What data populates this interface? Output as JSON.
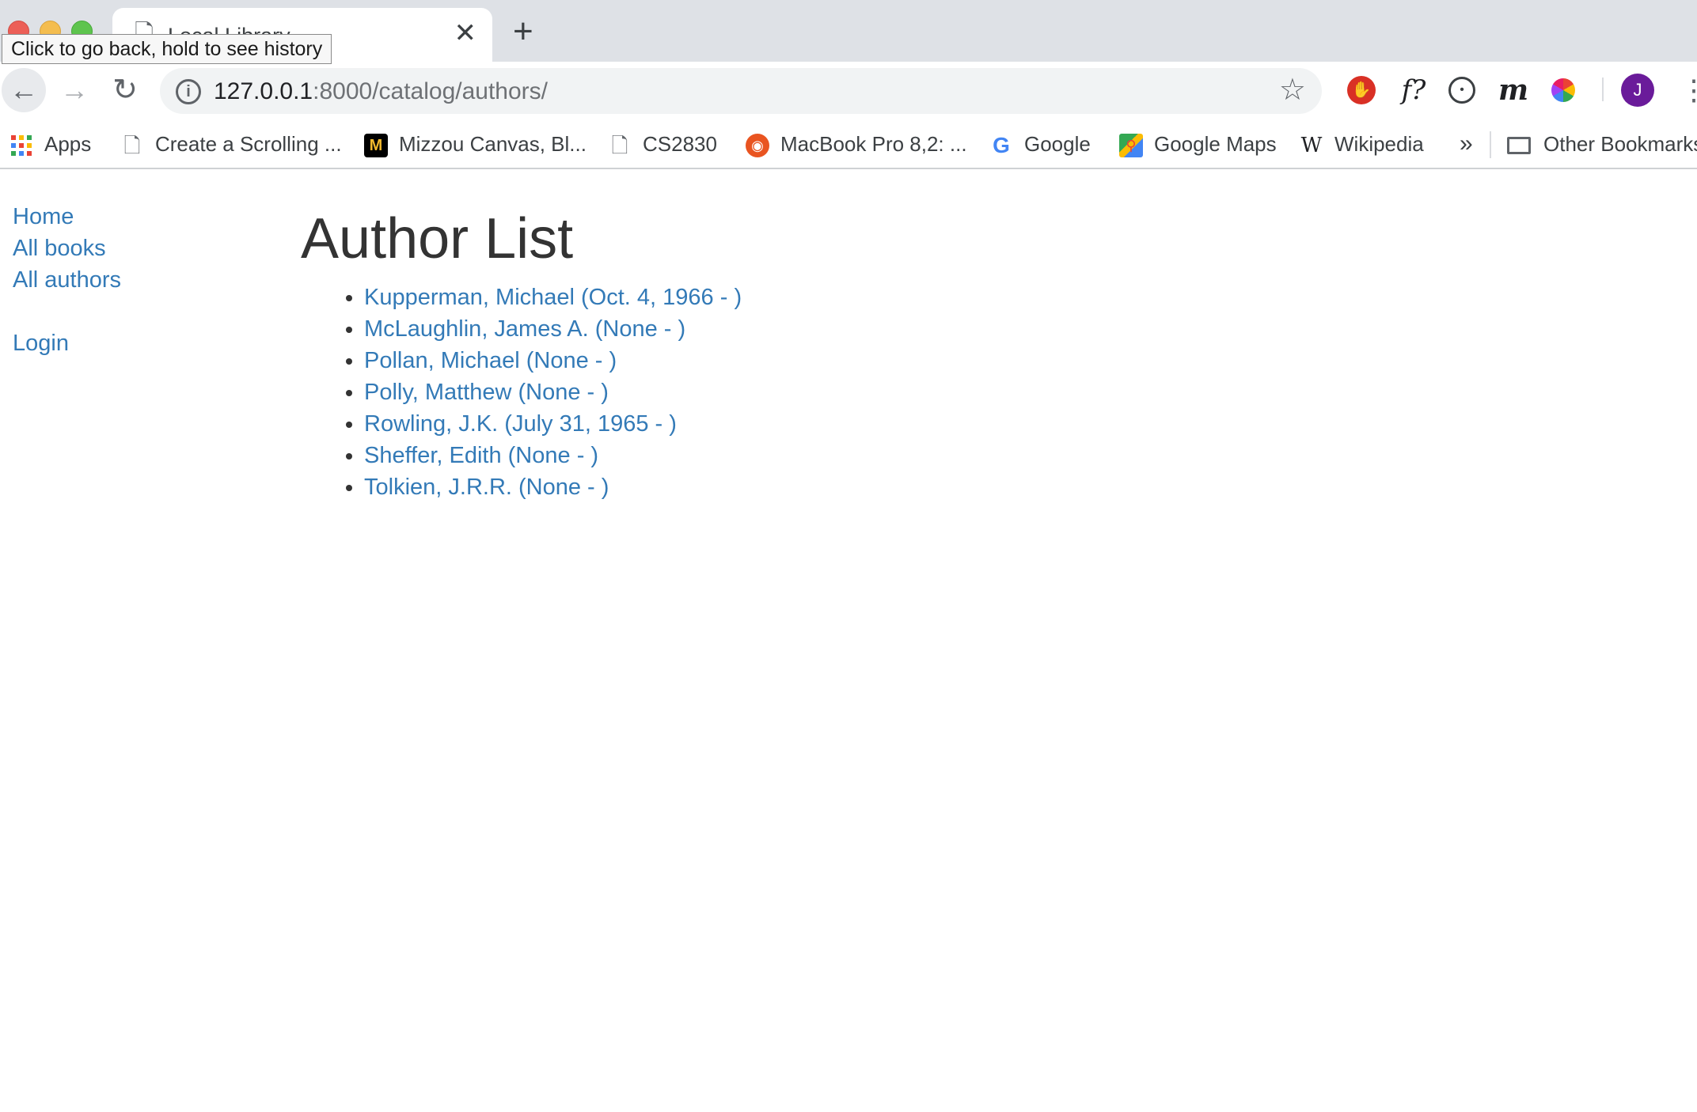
{
  "browser": {
    "tab_title": "Local Library",
    "tooltip": "Click to go back, hold to see history",
    "new_tab_symbol": "+",
    "close_symbol": "✕",
    "url_host": "127.0.0.1",
    "url_rest": ":8000/catalog/authors/",
    "avatar_letter": "J",
    "extensions": {
      "f_label": "f?",
      "m_label": "m"
    }
  },
  "bookmarks": {
    "items": [
      {
        "label": "Apps",
        "icon": "apps-grid-icon"
      },
      {
        "label": "Create a Scrolling ...",
        "icon": "page-icon"
      },
      {
        "label": "Mizzou Canvas, Bl...",
        "icon": "mizzou-icon"
      },
      {
        "label": "CS2830",
        "icon": "page-icon"
      },
      {
        "label": "MacBook Pro 8,2: ...",
        "icon": "ubuntu-icon"
      },
      {
        "label": "Google",
        "icon": "google-icon"
      },
      {
        "label": "Google Maps",
        "icon": "google-maps-icon"
      },
      {
        "label": "Wikipedia",
        "icon": "wikipedia-icon"
      }
    ],
    "more_symbol": "»",
    "other_bookmarks": "Other Bookmarks"
  },
  "sidebar": {
    "links": [
      {
        "label": "Home"
      },
      {
        "label": "All books"
      },
      {
        "label": "All authors"
      }
    ],
    "login_label": "Login"
  },
  "main": {
    "title": "Author List",
    "authors": [
      "Kupperman, Michael (Oct. 4, 1966 - )",
      "McLaughlin, James A. (None - )",
      "Pollan, Michael (None - )",
      "Polly, Matthew (None - )",
      "Rowling, J.K. (July 31, 1965 - )",
      "Sheffer, Edith (None - )",
      "Tolkien, J.R.R. (None - )"
    ]
  },
  "colors": {
    "link": "#337ab7",
    "heading": "#333333",
    "tabstrip": "#dee1e6",
    "omnibox": "#f1f3f4"
  }
}
